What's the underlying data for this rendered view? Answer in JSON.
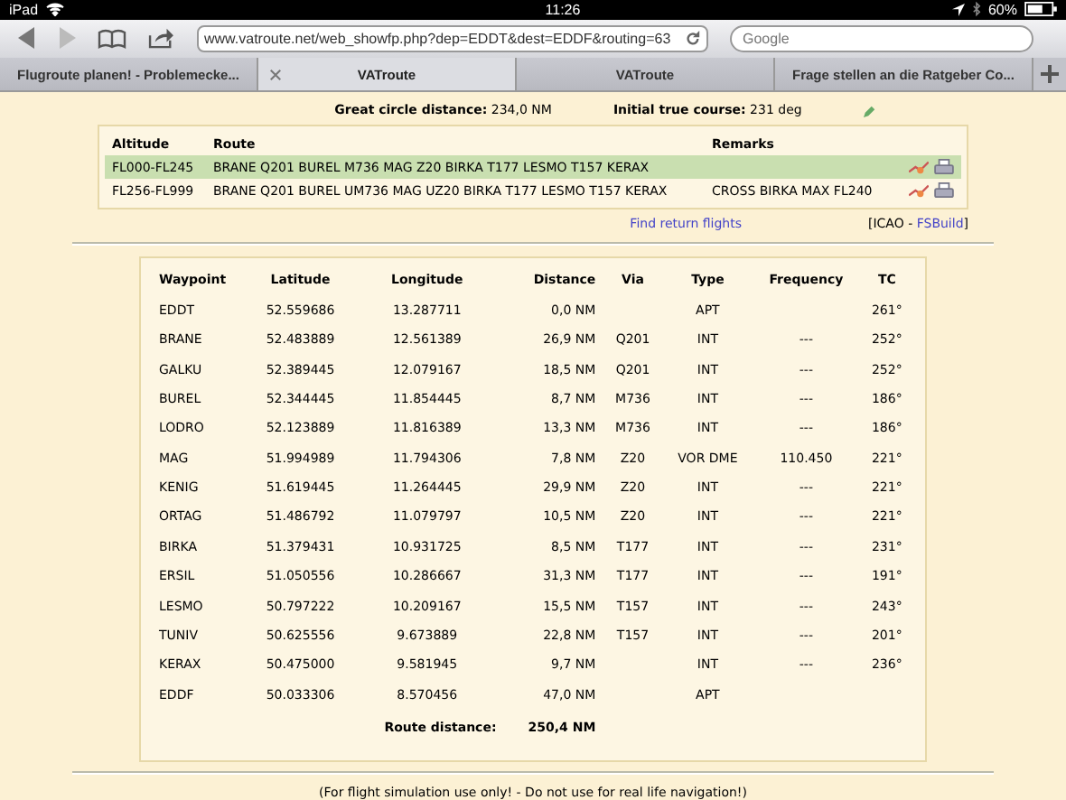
{
  "status_bar": {
    "device": "iPad",
    "time": "11:26",
    "battery": "60%"
  },
  "toolbar": {
    "url": "www.vatroute.net/web_showfp.php?dep=EDDT&dest=EDDF&routing=63",
    "search_placeholder": "Google"
  },
  "tabs": [
    {
      "label": "Flugroute planen! - Problemecke...",
      "selected": false
    },
    {
      "label": "VATroute",
      "selected": true
    },
    {
      "label": "VATroute",
      "selected": false
    },
    {
      "label": "Frage stellen an die Ratgeber Co...",
      "selected": false
    }
  ],
  "summary": {
    "distance_label": "Great circle distance:",
    "distance_value": "234,0 NM",
    "course_label": "Initial true course:",
    "course_value": "231 deg"
  },
  "routes": {
    "columns": [
      "Altitude",
      "Route",
      "Remarks"
    ],
    "rows": [
      {
        "altitude": "FL000-FL245",
        "route": "BRANE Q201 BUREL M736 MAG Z20 BIRKA T177 LESMO T157 KERAX",
        "remarks": "",
        "selected": true
      },
      {
        "altitude": "FL256-FL999",
        "route": "BRANE Q201 BUREL UM736 MAG UZ20 BIRKA T177 LESMO T157 KERAX",
        "remarks": "CROSS BIRKA MAX FL240",
        "selected": false
      }
    ]
  },
  "links": {
    "return_flights": "Find return flights",
    "export_prefix": "[ICAO - ",
    "export_link": "FSBuild",
    "export_suffix": "]"
  },
  "waypoints": {
    "columns": [
      "Waypoint",
      "Latitude",
      "Longitude",
      "Distance",
      "Via",
      "Type",
      "Frequency",
      "TC"
    ],
    "rows": [
      [
        "EDDT",
        "52.559686",
        "13.287711",
        "0,0 NM",
        "",
        "APT",
        "",
        "261°"
      ],
      [
        "BRANE",
        "52.483889",
        "12.561389",
        "26,9 NM",
        "Q201",
        "INT",
        "---",
        "252°"
      ],
      [
        "GALKU",
        "52.389445",
        "12.079167",
        "18,5 NM",
        "Q201",
        "INT",
        "---",
        "252°"
      ],
      [
        "BUREL",
        "52.344445",
        "11.854445",
        "8,7 NM",
        "M736",
        "INT",
        "---",
        "186°"
      ],
      [
        "LODRO",
        "52.123889",
        "11.816389",
        "13,3 NM",
        "M736",
        "INT",
        "---",
        "186°"
      ],
      [
        "MAG",
        "51.994989",
        "11.794306",
        "7,8 NM",
        "Z20",
        "VOR DME",
        "110.450",
        "221°"
      ],
      [
        "KENIG",
        "51.619445",
        "11.264445",
        "29,9 NM",
        "Z20",
        "INT",
        "---",
        "221°"
      ],
      [
        "ORTAG",
        "51.486792",
        "11.079797",
        "10,5 NM",
        "Z20",
        "INT",
        "---",
        "221°"
      ],
      [
        "BIRKA",
        "51.379431",
        "10.931725",
        "8,5 NM",
        "T177",
        "INT",
        "---",
        "231°"
      ],
      [
        "ERSIL",
        "51.050556",
        "10.286667",
        "31,3 NM",
        "T177",
        "INT",
        "---",
        "191°"
      ],
      [
        "LESMO",
        "50.797222",
        "10.209167",
        "15,5 NM",
        "T157",
        "INT",
        "---",
        "243°"
      ],
      [
        "TUNIV",
        "50.625556",
        "9.673889",
        "22,8 NM",
        "T157",
        "INT",
        "---",
        "201°"
      ],
      [
        "KERAX",
        "50.475000",
        "9.581945",
        "9,7 NM",
        "",
        "INT",
        "---",
        "236°"
      ],
      [
        "EDDF",
        "50.033306",
        "8.570456",
        "47,0 NM",
        "",
        "APT",
        "",
        ""
      ]
    ],
    "total_label": "Route distance:",
    "total_value": "250,4 NM"
  },
  "footer": "(For flight simulation use only! - Do not use for real life navigation!)"
}
